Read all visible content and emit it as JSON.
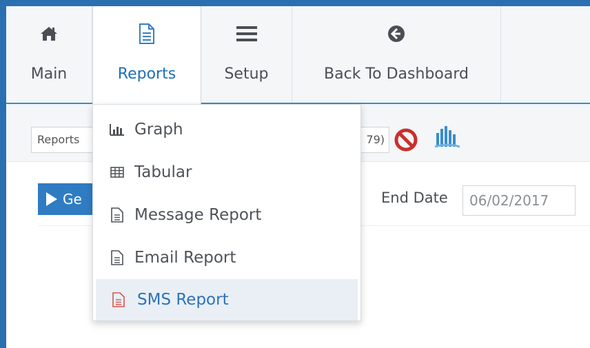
{
  "nav": {
    "items": [
      {
        "label": "Main",
        "icon": "home-icon"
      },
      {
        "label": "Reports",
        "icon": "document-icon"
      },
      {
        "label": "Setup",
        "icon": "bars-icon"
      },
      {
        "label": "Back To Dashboard",
        "icon": "arrow-circle-left-icon"
      }
    ],
    "active": "Reports"
  },
  "toolbar": {
    "reports_select_value": "Reports",
    "other_select_value": "79)"
  },
  "content": {
    "go_button_label": "Ge",
    "end_date_label": "End Date",
    "end_date_value": "06/02/2017"
  },
  "dropdown": {
    "items": [
      {
        "label": "Graph",
        "icon": "bar-chart-icon"
      },
      {
        "label": "Tabular",
        "icon": "table-icon"
      },
      {
        "label": "Message Report",
        "icon": "file-text-icon"
      },
      {
        "label": "Email Report",
        "icon": "file-text-icon"
      },
      {
        "label": "SMS Report",
        "icon": "file-text-icon"
      }
    ],
    "highlighted": "SMS Report"
  },
  "colors": {
    "accent": "#2a6fb0",
    "active_text": "#1e6fb6",
    "button": "#2f7cc3",
    "cancel": "#c9302c",
    "sms_icon": "#d9534f"
  }
}
